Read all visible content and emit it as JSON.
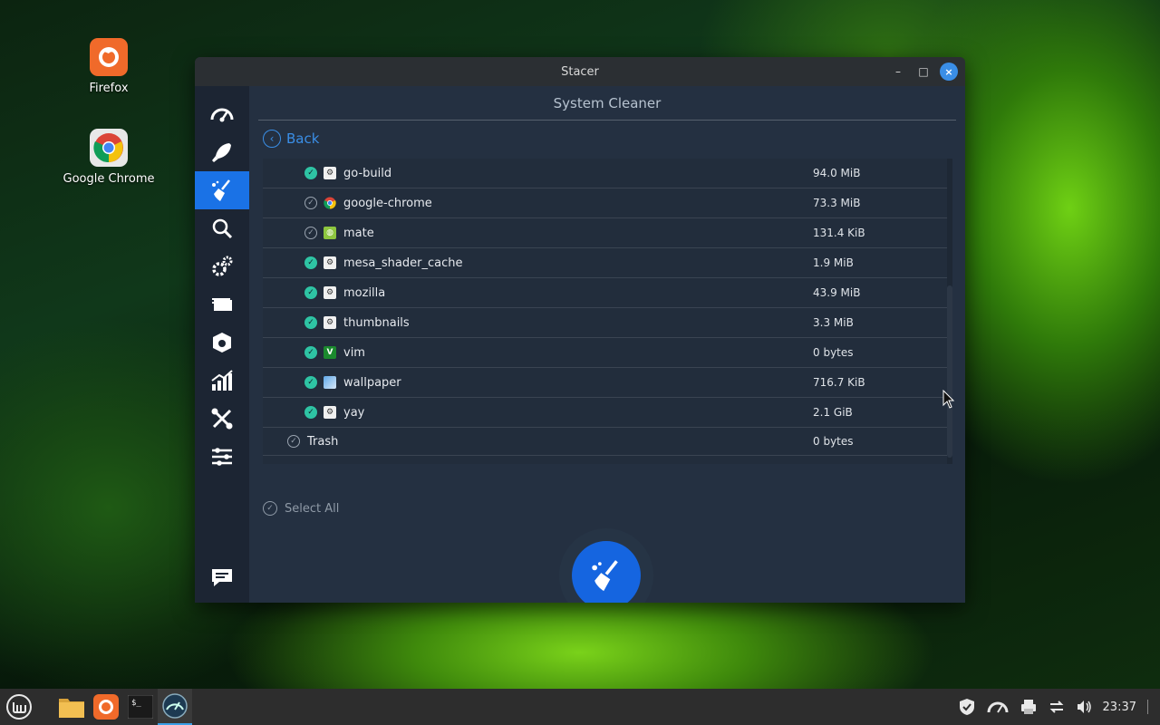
{
  "desktop": {
    "icons": [
      {
        "label": "Firefox"
      },
      {
        "label": "Google Chrome"
      }
    ]
  },
  "window": {
    "title": "Stacer",
    "controls": {
      "minimize": "–",
      "maximize": "□",
      "close": "×"
    }
  },
  "sidebar": {
    "items": [
      {
        "name": "dashboard-icon"
      },
      {
        "name": "startup-apps-icon"
      },
      {
        "name": "system-cleaner-icon",
        "active": true
      },
      {
        "name": "search-icon"
      },
      {
        "name": "services-icon"
      },
      {
        "name": "processes-icon"
      },
      {
        "name": "uninstaller-icon"
      },
      {
        "name": "resources-icon"
      },
      {
        "name": "helpers-icon"
      },
      {
        "name": "settings-icon"
      },
      {
        "name": "feedback-icon"
      }
    ]
  },
  "cleaner": {
    "title": "System Cleaner",
    "back_label": "Back",
    "rows": [
      {
        "label": "go-build",
        "size": "94.0 MiB"
      },
      {
        "label": "google-chrome",
        "size": "73.3 MiB"
      },
      {
        "label": "mate",
        "size": "131.4 KiB"
      },
      {
        "label": "mesa_shader_cache",
        "size": "1.9 MiB"
      },
      {
        "label": "mozilla",
        "size": "43.9 MiB"
      },
      {
        "label": "thumbnails",
        "size": "3.3 MiB"
      },
      {
        "label": "vim",
        "size": "0 bytes"
      },
      {
        "label": "wallpaper",
        "size": "716.7 KiB"
      },
      {
        "label": "yay",
        "size": "2.1 GiB"
      },
      {
        "label": "Trash",
        "size": "0 bytes"
      }
    ],
    "select_all_label": "Select All"
  },
  "taskbar": {
    "clock": "23:37"
  },
  "colors": {
    "accent": "#1a72e6",
    "check": "#2ec4a4"
  }
}
